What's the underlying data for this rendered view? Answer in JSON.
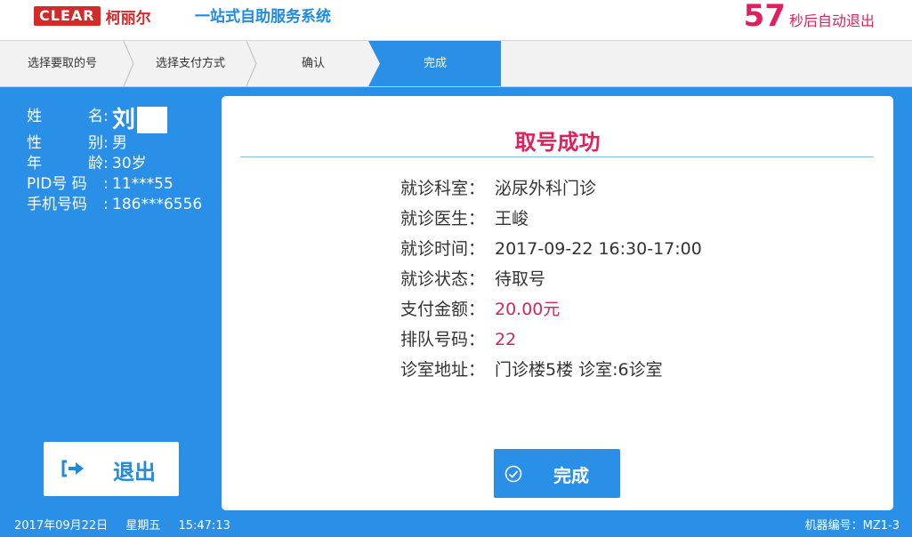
{
  "header": {
    "logo_text": "CLEAR",
    "logo_cn": "柯丽尔",
    "system_title": "一站式自助服务系统",
    "countdown_value": "57",
    "countdown_text": "秒后自动退出"
  },
  "steps": [
    {
      "label": "选择要取的号",
      "active": false
    },
    {
      "label": "选择支付方式",
      "active": false
    },
    {
      "label": "确认",
      "active": false
    },
    {
      "label": "完成",
      "active": true
    }
  ],
  "patient": {
    "name_label": [
      "姓",
      "名"
    ],
    "name_value": "刘",
    "gender_label": [
      "性",
      "别"
    ],
    "gender_value": "男",
    "age_label": [
      "年",
      "龄"
    ],
    "age_value": "30岁",
    "pid_label": "PID号 码",
    "pid_value": "11***55",
    "phone_label": "手机号码",
    "phone_value": "186***6556",
    "colon": ":"
  },
  "exit_button": {
    "label": "退出",
    "icon": "logout-icon"
  },
  "card": {
    "title": "取号成功",
    "rows": [
      {
        "label": "就诊科室：",
        "value": "泌尿外科门诊",
        "highlight": false
      },
      {
        "label": "就诊医生：",
        "value": "王峻",
        "highlight": false
      },
      {
        "label": "就诊时间：",
        "value": "2017-09-22 16:30-17:00",
        "highlight": false
      },
      {
        "label": "就诊状态：",
        "value": "待取号",
        "highlight": false
      },
      {
        "label": "支付金额：",
        "value": "20.00元",
        "highlight": true
      },
      {
        "label": "排队号码：",
        "value": "22",
        "highlight": true
      },
      {
        "label": "诊室地址：",
        "value": "门诊楼5楼 诊室:6诊室",
        "highlight": false
      }
    ],
    "done_button": {
      "label": "完成",
      "icon": "check-circle-icon"
    }
  },
  "footer": {
    "date": "2017年09月22日",
    "weekday": "星期五",
    "time": "15:47:13",
    "machine": "机器编号：MZ1-3"
  },
  "colors": {
    "primary_blue": "#2a8fe6",
    "accent_red": "#e0205a",
    "logo_red": "#d42a2a"
  }
}
